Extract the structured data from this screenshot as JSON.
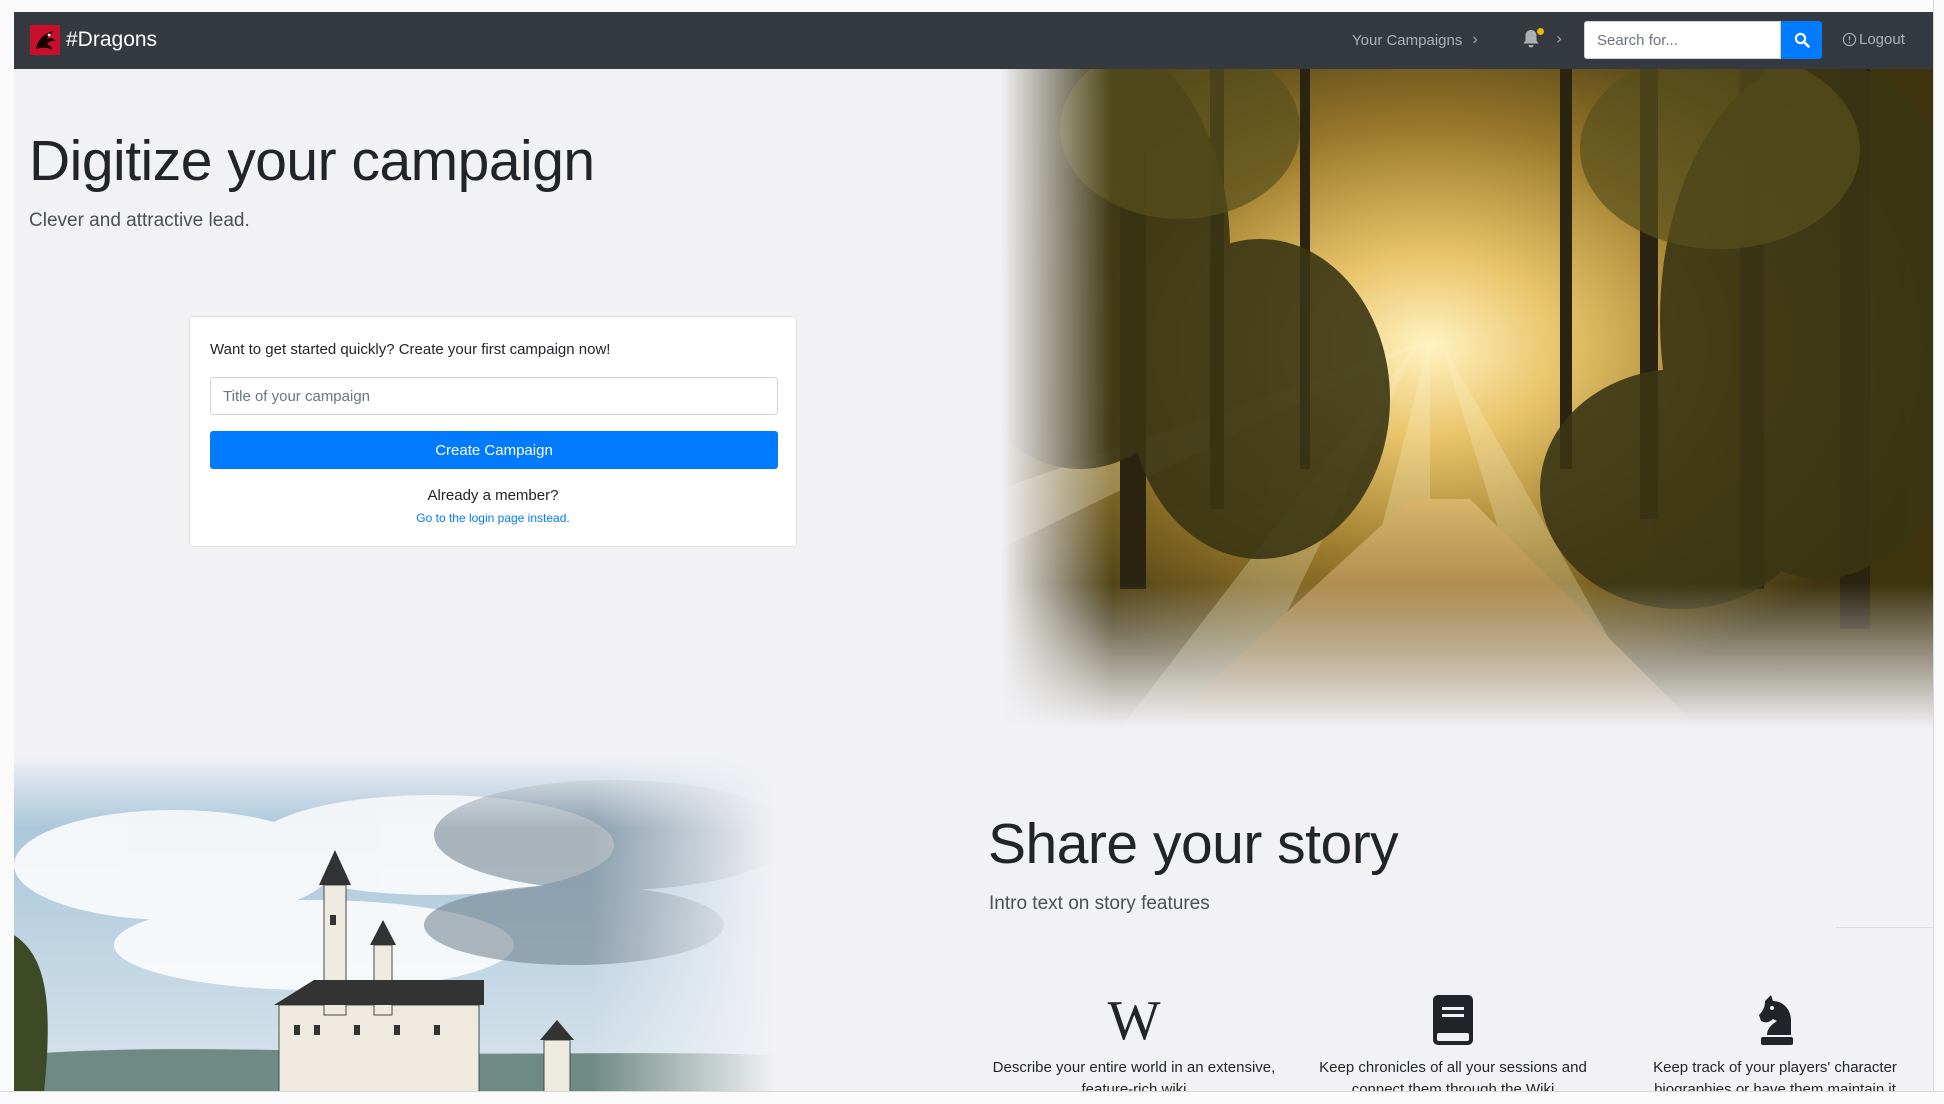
{
  "navbar": {
    "brand": "#Dragons",
    "campaigns_label": "Your Campaigns",
    "search_placeholder": "Search for...",
    "logout_label": "Logout"
  },
  "hero": {
    "title": "Digitize your campaign",
    "lead": "Clever and attractive lead."
  },
  "signup_card": {
    "prompt": "Want to get started quickly? Create your first campaign now!",
    "input_placeholder": "Title of your campaign",
    "button_label": "Create Campaign",
    "member_text": "Already a member?",
    "login_link": "Go to the login page instead."
  },
  "story": {
    "title": "Share your story",
    "lead": "Intro text on story features",
    "features": [
      {
        "icon": "wikipedia-icon",
        "text": "Describe your entire world in an extensive, feature-rich wiki"
      },
      {
        "icon": "book-icon",
        "text": "Keep chronicles of all your sessions and connect them through the Wiki"
      },
      {
        "icon": "chess-knight-icon",
        "text": "Keep track of your players' character biographies or have them maintain it"
      }
    ]
  },
  "colors": {
    "navbar_bg": "#343a40",
    "primary": "#007bff",
    "page_bg": "#f2f2f5",
    "notification_dot": "#f0b400"
  }
}
